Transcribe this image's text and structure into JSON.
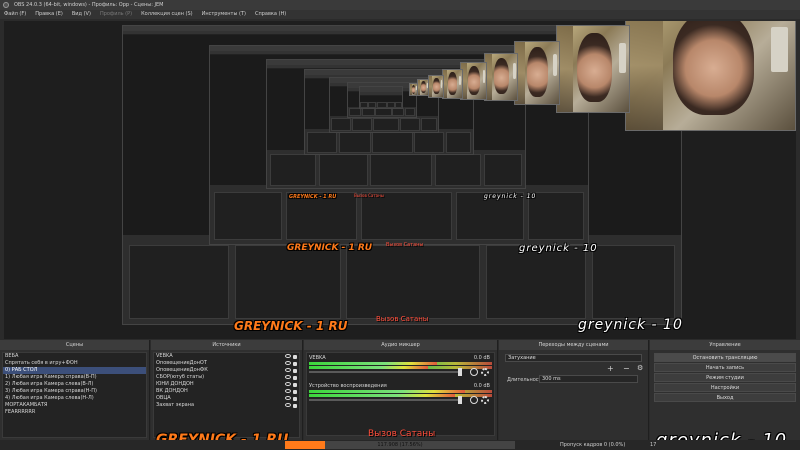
{
  "window": {
    "title": "OBS 24.0.3 (64-bit, windows) - Профиль: Орр - Сцены: JEM"
  },
  "menu": [
    {
      "label": "Файл (F)",
      "disabled": false
    },
    {
      "label": "Правка (E)",
      "disabled": false
    },
    {
      "label": "Вид (V)",
      "disabled": false
    },
    {
      "label": "Профиль (P)",
      "disabled": true
    },
    {
      "label": "Коллекция сцен (S)",
      "disabled": false
    },
    {
      "label": "Инструменты (T)",
      "disabled": false
    },
    {
      "label": "Справка (H)",
      "disabled": false
    }
  ],
  "overlay": {
    "watermark": "GREYNICK - 1 RU",
    "caption": "Вызов Сатаны",
    "signature": "greynick - 10"
  },
  "scenes": {
    "title": "Сцены",
    "items": [
      {
        "label": "ВЕБА",
        "selected": false
      },
      {
        "label": "Спрятать себя в игру+ФОН",
        "selected": false
      },
      {
        "label": "0) РАБ СТОЛ",
        "selected": true
      },
      {
        "label": "1) Любая игра Камера справа(В-П)",
        "selected": false
      },
      {
        "label": "2) Любая игра Камера слева(В-Л)",
        "selected": false
      },
      {
        "label": "3) Любая игра Камера справа(Н-П)",
        "selected": false
      },
      {
        "label": "4) Любая игра Камера слева(Н-Л)",
        "selected": false
      },
      {
        "label": "МОРТАКАМБАТЯ",
        "selected": false
      },
      {
        "label": "FEARRRRRR",
        "selected": false
      }
    ]
  },
  "sources": {
    "title": "Источники",
    "items": [
      {
        "label": "VEBKA"
      },
      {
        "label": "ОповещениеДонОТ"
      },
      {
        "label": "ОповещениеДонФК"
      },
      {
        "label": "СБОР(ютуб статы)"
      },
      {
        "label": "ЮНИ ДОНДОН"
      },
      {
        "label": "ВК ДОНДОН"
      },
      {
        "label": "ОВЦА"
      },
      {
        "label": "Захват экрана"
      }
    ]
  },
  "mixer": {
    "title": "Аудио микшер",
    "tracks": [
      {
        "name": "VEBKA",
        "db": "0.0 dB",
        "level": 0.7
      },
      {
        "name": "Устройство воспроизведения",
        "db": "0.0 dB",
        "level": 0.85
      }
    ]
  },
  "transitions": {
    "title": "Переходы между сценами",
    "type": "Затухание",
    "duration_label": "Длительность",
    "duration_value": "300 ms"
  },
  "controls": {
    "title": "Управление",
    "buttons": [
      {
        "label": "Остановить трансляцию",
        "active": true
      },
      {
        "label": "Начать запись",
        "active": false
      },
      {
        "label": "Режим студии",
        "active": false
      },
      {
        "label": "Настройки",
        "active": false
      },
      {
        "label": "Выход",
        "active": false
      }
    ]
  },
  "status": {
    "dropped_frames": "Пропуск кадров 0 (0.0%)",
    "progress_label": "117.908 (17.56%)",
    "progress_fraction": 0.1756,
    "kbps_partial": "17"
  },
  "footer_icons": {
    "add": "+",
    "remove": "−",
    "up": "⌃",
    "down": "⌄",
    "settings": "⚙"
  },
  "colors": {
    "accent": "#ff7a1a",
    "selection": "#3c4f7a",
    "caption": "#ff4d3a"
  }
}
